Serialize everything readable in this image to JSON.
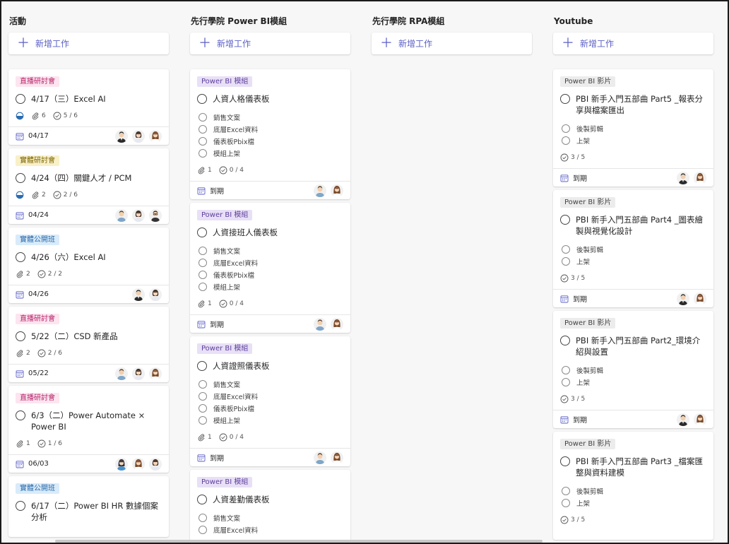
{
  "add_task_label": "新增工作",
  "colors": {
    "accent": "#5b5fc7",
    "tag_live": {
      "bg": "#fde4ef",
      "fg": "#b4246a"
    },
    "tag_physical_seminar": {
      "bg": "#f8f0c8",
      "fg": "#7a6200"
    },
    "tag_open_class": {
      "bg": "#d9ebfa",
      "fg": "#2a6aa8"
    },
    "tag_powerbi_module": {
      "bg": "#e8e0f6",
      "fg": "#5e3f9c"
    },
    "tag_powerbi_video": {
      "bg": "#ececec",
      "fg": "#444444"
    }
  },
  "buckets": [
    {
      "title": "活動",
      "cards": [
        {
          "tag": "直播研討會",
          "tag_style": "tag_live",
          "title": "4/17（三）Excel AI",
          "progress": "half",
          "attachments": "6",
          "checks": "5 / 6",
          "due": "04/17",
          "avatars": [
            "man-suit",
            "woman-short",
            "woman-long"
          ]
        },
        {
          "tag": "實體研討會",
          "tag_style": "tag_physical_seminar",
          "title": "4/24（四）關鍵人才 / PCM",
          "progress": "half",
          "attachments": "2",
          "checks": "2 / 6",
          "due": "04/24",
          "avatars": [
            "man-casual",
            "woman-short",
            "man-glasses"
          ]
        },
        {
          "tag": "實體公開班",
          "tag_style": "tag_open_class",
          "title": "4/26（六）Excel AI",
          "progress": "",
          "attachments": "2",
          "checks": "2 / 2",
          "due": "04/26",
          "avatars": [
            "man-suit",
            "woman-short"
          ]
        },
        {
          "tag": "直播研討會",
          "tag_style": "tag_live",
          "title": "5/22（二）CSD 新產品",
          "progress": "",
          "attachments": "2",
          "checks": "2 / 6",
          "due": "05/22",
          "avatars": [
            "man-casual",
            "woman-short",
            "woman-long"
          ]
        },
        {
          "tag": "直播研討會",
          "tag_style": "tag_live",
          "title": "6/3（二）Power Automate × Power BI",
          "progress": "",
          "attachments": "1",
          "checks": "1 / 6",
          "due": "06/03",
          "avatars": [
            "woman-blue",
            "woman-long",
            "woman-short"
          ]
        },
        {
          "tag": "實體公開班",
          "tag_style": "tag_open_class",
          "title": "6/17（二）Power BI HR 數據個案分析",
          "progress": "",
          "attachments": "",
          "checks": "",
          "due": "",
          "avatars": []
        }
      ]
    },
    {
      "title": "先行學院 Power BI模組",
      "cards": [
        {
          "tag": "Power BI 模組",
          "tag_style": "tag_powerbi_module",
          "title": "人資人格儀表板",
          "checklist": [
            "銷售文案",
            "底層Excel資料",
            "儀表板Pbix檔",
            "模組上架"
          ],
          "attachments": "1",
          "checks": "0 / 4",
          "due": "到期",
          "avatars": [
            "man-casual",
            "woman-long"
          ]
        },
        {
          "tag": "Power BI 模組",
          "tag_style": "tag_powerbi_module",
          "title": "人資接班人儀表板",
          "checklist": [
            "銷售文案",
            "底層Excel資料",
            "儀表板Pbix檔",
            "模組上架"
          ],
          "attachments": "1",
          "checks": "0 / 4",
          "due": "到期",
          "avatars": [
            "man-casual",
            "woman-long"
          ]
        },
        {
          "tag": "Power BI 模組",
          "tag_style": "tag_powerbi_module",
          "title": "人資證照儀表板",
          "checklist": [
            "銷售文案",
            "底層Excel資料",
            "儀表板Pbix檔",
            "模組上架"
          ],
          "attachments": "1",
          "checks": "0 / 4",
          "due": "到期",
          "avatars": [
            "man-casual",
            "woman-long"
          ]
        },
        {
          "tag": "Power BI 模組",
          "tag_style": "tag_powerbi_module",
          "title": "人資差勤儀表板",
          "checklist": [
            "銷售文案",
            "底層Excel資料"
          ],
          "attachments": "",
          "checks": "",
          "due": "",
          "avatars": []
        }
      ]
    },
    {
      "title": "先行學院 RPA模組",
      "cards": []
    },
    {
      "title": "Youtube",
      "cards": [
        {
          "tag": "Power BI 影片",
          "tag_style": "tag_powerbi_video",
          "title": "PBI 新手入門五部曲 Part5 _報表分享與檔案匯出",
          "checklist": [
            "後製剪輯",
            "上架"
          ],
          "attachments": "",
          "checks": "3 / 5",
          "due": "到期",
          "avatars": [
            "man-suit",
            "woman-long"
          ]
        },
        {
          "tag": "Power BI 影片",
          "tag_style": "tag_powerbi_video",
          "title": "PBI 新手入門五部曲 Part4 _圖表繪製與視覺化設計",
          "checklist": [
            "後製剪輯",
            "上架"
          ],
          "attachments": "",
          "checks": "3 / 5",
          "due": "到期",
          "avatars": [
            "man-suit",
            "woman-long"
          ]
        },
        {
          "tag": "Power BI 影片",
          "tag_style": "tag_powerbi_video",
          "title": "PBI 新手入門五部曲 Part2_環境介紹與設置",
          "checklist": [
            "後製剪輯",
            "上架"
          ],
          "attachments": "",
          "checks": "3 / 5",
          "due": "到期",
          "avatars": [
            "man-suit",
            "woman-long"
          ]
        },
        {
          "tag": "Power BI 影片",
          "tag_style": "tag_powerbi_video",
          "title": "PBI 新手入門五部曲 Part3 _檔案匯整與資料建模",
          "checklist": [
            "後製剪輯",
            "上架"
          ],
          "attachments": "",
          "checks": "3 / 5",
          "due": "",
          "avatars": []
        }
      ]
    }
  ]
}
